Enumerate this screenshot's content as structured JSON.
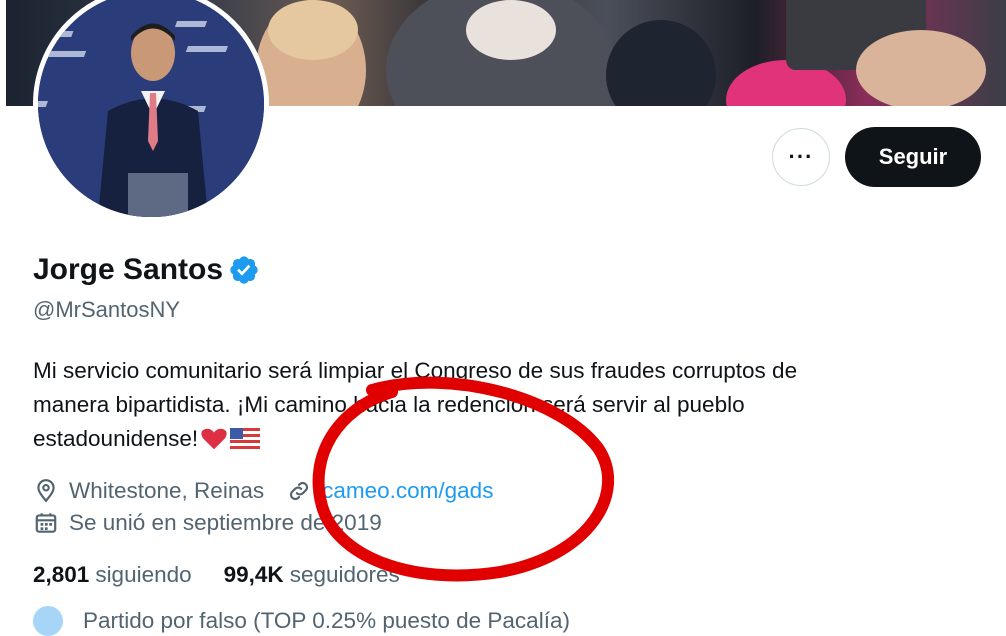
{
  "profile": {
    "display_name": "Jorge Santos",
    "handle": "@MrSantosNY",
    "bio_line1": "Mi servicio comunitario será limpiar el Congreso de sus fraudes corruptos de",
    "bio_line2": "manera bipartidista. ¡Mi camino hacia la redención será servir al pueblo",
    "bio_line3": "estadounidense!",
    "location": "Whitestone, Reinas",
    "website": "cameo.com/gads",
    "joined": "Se unió en septiembre de 2019",
    "verified": true
  },
  "actions": {
    "more_label": "···",
    "follow_label": "Seguir"
  },
  "stats": {
    "following_count": "2,801",
    "following_label": "siguiendo",
    "followers_count": "99,4K",
    "followers_label": "seguidores"
  },
  "partial_line": "Partido por falso (TOP 0.25% puesto de Pacalía)",
  "colors": {
    "accent": "#1d9bf0",
    "annotation": "#e00000",
    "follow_bg": "#0f1419"
  },
  "icons": [
    "more-icon",
    "verified-badge-icon",
    "heart-emoji-icon",
    "us-flag-emoji-icon",
    "location-pin-icon",
    "link-icon",
    "calendar-icon"
  ]
}
